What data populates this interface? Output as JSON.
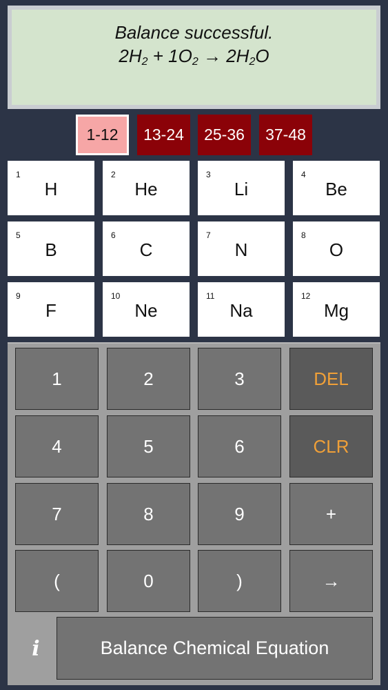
{
  "display": {
    "status": "Balance successful.",
    "equation": {
      "term1_coef": "2H",
      "term1_sub": "2",
      "plus": " + ",
      "term2_coef": "1O",
      "term2_sub": "2",
      "arrow": " → ",
      "term3_a": "2H",
      "term3_sub": "2",
      "term3_b": "O"
    }
  },
  "range_tabs": [
    "1-12",
    "13-24",
    "25-36",
    "37-48"
  ],
  "active_range": "1-12",
  "elements": [
    {
      "num": "1",
      "sym": "H"
    },
    {
      "num": "2",
      "sym": "He"
    },
    {
      "num": "3",
      "sym": "Li"
    },
    {
      "num": "4",
      "sym": "Be"
    },
    {
      "num": "5",
      "sym": "B"
    },
    {
      "num": "6",
      "sym": "C"
    },
    {
      "num": "7",
      "sym": "N"
    },
    {
      "num": "8",
      "sym": "O"
    },
    {
      "num": "9",
      "sym": "F"
    },
    {
      "num": "10",
      "sym": "Ne"
    },
    {
      "num": "11",
      "sym": "Na"
    },
    {
      "num": "12",
      "sym": "Mg"
    }
  ],
  "keys": {
    "k1": "1",
    "k2": "2",
    "k3": "3",
    "del": "DEL",
    "k4": "4",
    "k5": "5",
    "k6": "6",
    "clr": "CLR",
    "k7": "7",
    "k8": "8",
    "k9": "9",
    "plus": "+",
    "lparen": "(",
    "k0": "0",
    "rparen": ")",
    "arrow": "→"
  },
  "info_icon": "i",
  "balance_button_label": "Balance Chemical Equation",
  "colors": {
    "background": "#2c3446",
    "display_bg": "#d4e4cd",
    "tab_inactive": "#8b0208",
    "tab_active": "#f6a6a6",
    "function_key_text": "#f0a038"
  }
}
